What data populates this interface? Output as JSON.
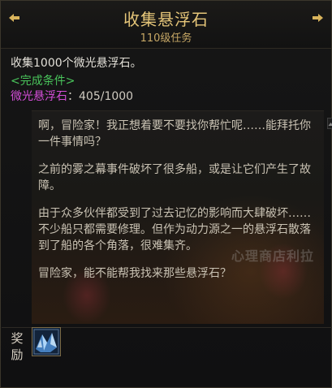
{
  "quest": {
    "title": "收集悬浮石",
    "subtitle": "110级任务"
  },
  "objective": {
    "text": "收集1000个微光悬浮石。",
    "condition_label": "<完成条件>",
    "item_name": "微光悬浮石",
    "separator": "：",
    "current": "405",
    "slash": "/",
    "total": "1000"
  },
  "dialog": {
    "paragraphs": [
      "啊，冒险家！我正想着要不要找你帮忙呢……能拜托你一件事情吗？",
      "之前的雾之幕事件破坏了很多船，或是让它们产生了故障。",
      "由于众多伙伴都受到了过去记忆的影响而大肆破坏……不少船只都需要修理。但作为动力源之一的悬浮石散落到了船的各个角落，很难集齐。",
      "冒险家，能不能帮我找来那些悬浮石？"
    ],
    "watermark": "心理商店利拉"
  },
  "reward": {
    "label": "奖励",
    "item_icon": "crystal-item-icon"
  },
  "colors": {
    "title": "#e6c679",
    "condition": "#49c45b",
    "item": "#d24dd6"
  }
}
